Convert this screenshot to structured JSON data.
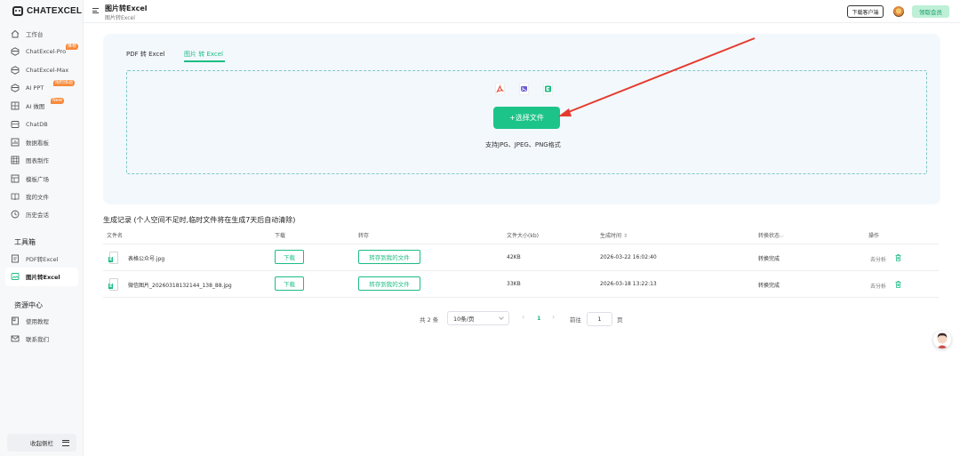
{
  "app": {
    "logo_text": "CHATEXCEL"
  },
  "sidebar": {
    "items": [
      {
        "label": "工作台",
        "icon": "home-icon"
      },
      {
        "label": "ChatExcel-Pro",
        "icon": "hexagon-icon",
        "badge": "推荐"
      },
      {
        "label": "ChatExcel-Max",
        "icon": "hexagon-icon"
      },
      {
        "label": "AI PPT",
        "icon": "hexagon-icon",
        "badge": "限时体验"
      },
      {
        "label": "AI 做图",
        "icon": "image-grid-icon",
        "badge": "New"
      },
      {
        "label": "ChatDB",
        "icon": "database-icon"
      },
      {
        "label": "数据看板",
        "icon": "dashboard-icon"
      },
      {
        "label": "图表制作",
        "icon": "table-icon"
      },
      {
        "label": "模板广场",
        "icon": "template-icon"
      },
      {
        "label": "我的文件",
        "icon": "book-icon"
      },
      {
        "label": "历史会话",
        "icon": "clock-icon"
      }
    ],
    "tools_title": "工具箱",
    "tools": [
      {
        "label": "PDF转Excel",
        "icon": "pdf-file-icon"
      },
      {
        "label": "图片转Excel",
        "icon": "image-file-icon",
        "active": true
      }
    ],
    "resources_title": "资源中心",
    "resources": [
      {
        "label": "使用教程",
        "icon": "tutorial-icon"
      },
      {
        "label": "联系我们",
        "icon": "mail-icon"
      }
    ],
    "collapse_label": "收起侧栏"
  },
  "header": {
    "title": "图片转Excel",
    "subtitle": "图片转Excel",
    "download_client": "下载客户端",
    "free_btn": "领取会员"
  },
  "upload": {
    "tabs": [
      "PDF 转 Excel",
      "图片 转 Excel"
    ],
    "active_tab": 1,
    "file_icons": [
      "pdf-icon",
      "image-icon",
      "excel-icon"
    ],
    "select_button": "+选择文件",
    "support_text": "支持JPG、JPEG、PNG格式"
  },
  "records": {
    "title": "生成记录 (个人空间不足时,临时文件将在生成7天后自动清除)",
    "columns": [
      "文件名",
      "下载",
      "转存",
      "文件大小(kb)",
      "生成时间",
      "转换状态",
      "操作"
    ],
    "rows": [
      {
        "name": "表格公众号.jpg",
        "download": "下载",
        "save": "转存到我的文件",
        "size": "42KB",
        "time": "2026-03-22 16:02:40",
        "status": "转换完成",
        "action": "去分析"
      },
      {
        "name": "微信图片_20260318132144_138_88.jpg",
        "download": "下载",
        "save": "转存到我的文件",
        "size": "33KB",
        "time": "2026-03-18 13:22:13",
        "status": "转换完成",
        "action": "去分析"
      }
    ]
  },
  "pagination": {
    "total": "共 2 条",
    "page_size": "10条/页",
    "current": "1",
    "goto_label": "前往",
    "goto_value": "1",
    "page_suffix": "页",
    "prev": "‹",
    "next": "›"
  },
  "colors": {
    "accent": "#1dbd84",
    "badge": "#f78a3a",
    "arrow": "#e53a2d"
  }
}
